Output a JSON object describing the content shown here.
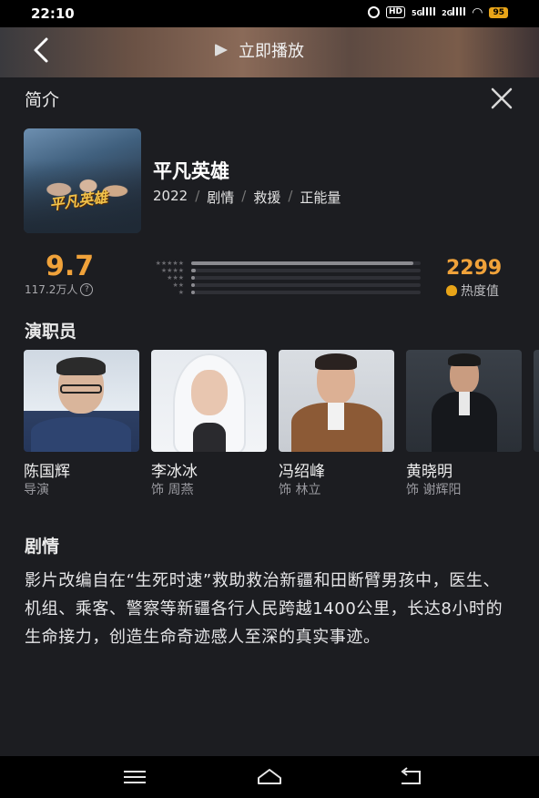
{
  "status": {
    "time": "22:10",
    "hd_label": "HD",
    "signal1_label": "5G",
    "signal2_label": "2G",
    "battery": "95"
  },
  "header": {
    "play_label": "立即播放"
  },
  "intro": {
    "title": "简介"
  },
  "movie": {
    "poster_logo": "平凡英雄",
    "title": "平凡英雄",
    "year": "2022",
    "tags": [
      "剧情",
      "救援",
      "正能量"
    ],
    "separator": "/"
  },
  "rating": {
    "score": "9.7",
    "count": "117.2万人",
    "help_icon": "?",
    "distribution": [
      0.97,
      0.02,
      0.005,
      0.003,
      0.002
    ],
    "star_rows": [
      "★★★★★",
      "★★★★",
      "★★★",
      "★★",
      "★"
    ],
    "heat_value": "2299",
    "heat_label": "热度值"
  },
  "cast": {
    "title": "演职员",
    "members": [
      {
        "name": "陈国辉",
        "role": "导演"
      },
      {
        "name": "李冰冰",
        "role": "饰 周燕"
      },
      {
        "name": "冯绍峰",
        "role": "饰 林立"
      },
      {
        "name": "黄晓明",
        "role": "饰 谢辉阳"
      }
    ]
  },
  "plot": {
    "title": "剧情",
    "text": "影片改编自在“生死时速”救助救治新疆和田断臂男孩中，医生、机组、乘客、警察等新疆各行人民跨越1400公里，长达8小时的生命接力，创造生命奇迹感人至深的真实事迹。"
  },
  "colors": {
    "accent": "#f0a23a",
    "background": "#1c1d21"
  }
}
